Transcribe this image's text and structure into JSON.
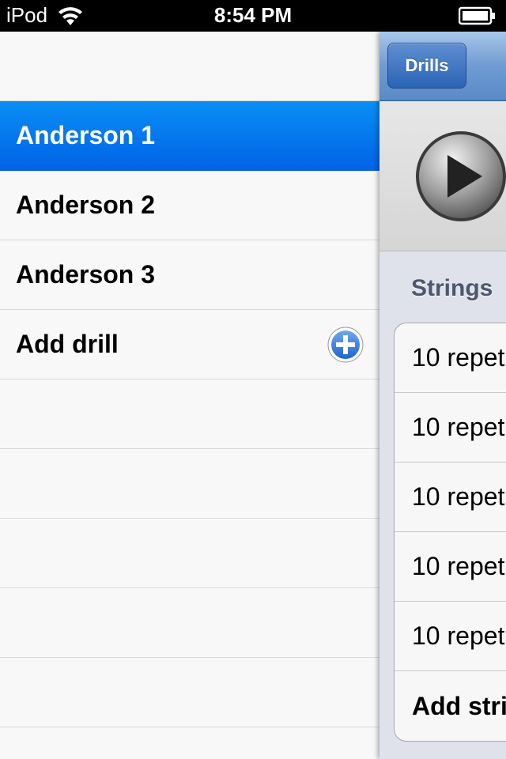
{
  "status": {
    "carrier": "iPod",
    "time": "8:54 PM"
  },
  "drills": {
    "items": [
      {
        "label": "Anderson 1",
        "selected": true
      },
      {
        "label": "Anderson 2",
        "selected": false
      },
      {
        "label": "Anderson 3",
        "selected": false
      }
    ],
    "add_label": "Add drill"
  },
  "detail": {
    "back_button_label": "Drills",
    "section_title": "Strings",
    "strings": [
      "10 repet",
      "10 repet",
      "10 repet",
      "10 repet",
      "10 repet"
    ],
    "add_string_label": "Add stri"
  },
  "icons": {
    "wifi": "wifi-icon",
    "battery": "battery-icon",
    "add": "plus-circle-icon",
    "play": "play-icon"
  },
  "colors": {
    "selected_row": "#0a7ef0",
    "nav_bar": "#6f9bd1",
    "add_icon": "#2f7ae0"
  }
}
